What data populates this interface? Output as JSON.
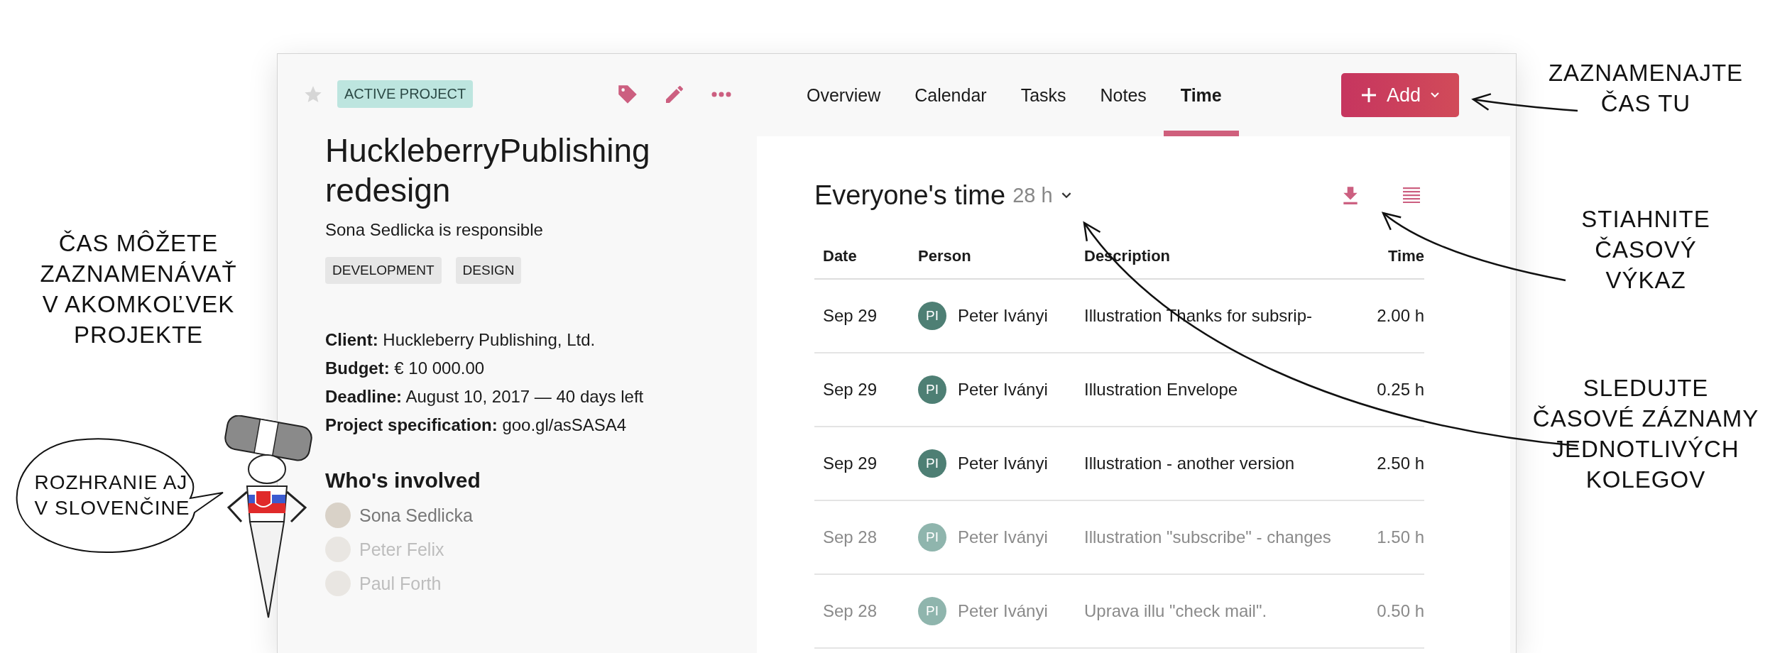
{
  "left_notes": {
    "caption": "ČAS MÔŽETE\nZAZNAMENÁVAŤ\nV AKOMKOĽVEK\nPROJEKTE",
    "speech_bubble": "ROZHRANIE AJ\nV SLOVENČINE"
  },
  "project": {
    "starred": false,
    "status": "ACTIVE PROJECT",
    "title": "HuckleberryPublishing redesign",
    "responsible": "Sona Sedlicka is responsible",
    "tags": [
      "DEVELOPMENT",
      "DESIGN"
    ],
    "details": [
      "**Client:** Huckleberry Publishing, Ltd.",
      "**Budget:** € 10 000.00",
      "**Deadline:** August 10, 2017 — 40 days left",
      "**Project specification:** goo.gl/asSASA4"
    ],
    "involved_heading": "Who's involved",
    "people": [
      {
        "name": "Sona Sedlicka",
        "faded": false
      },
      {
        "name": "Peter Felix",
        "faded": true
      },
      {
        "name": "Paul Forth",
        "faded": true
      }
    ]
  },
  "tabs": [
    {
      "label": "Overview",
      "selected": false
    },
    {
      "label": "Calendar",
      "selected": false
    },
    {
      "label": "Tasks",
      "selected": false
    },
    {
      "label": "Notes",
      "selected": false
    },
    {
      "label": "Time",
      "selected": true
    }
  ],
  "add_button": {
    "label": "Add"
  },
  "time_panel": {
    "title": "Everyone's time",
    "total": "28 h",
    "columns": [
      "Date",
      "Person",
      "Description",
      "Time"
    ],
    "rows": [
      {
        "date": "Sep 29",
        "initials": "PI",
        "person": "Peter Iványi",
        "description": "Illustration Thanks for subsrip-",
        "time": "2.00 h",
        "faded": false
      },
      {
        "date": "Sep 29",
        "initials": "PI",
        "person": "Peter Iványi",
        "description": "Illustration Envelope",
        "time": "0.25 h",
        "faded": false
      },
      {
        "date": "Sep 29",
        "initials": "PI",
        "person": "Peter Iványi",
        "description": "Illustration - another version",
        "time": "2.50 h",
        "faded": false
      },
      {
        "date": "Sep 28",
        "initials": "PI",
        "person": "Peter Iványi",
        "description": "Illustration \"subscribe\" - changes",
        "time": "1.50 h",
        "faded": true
      },
      {
        "date": "Sep 28",
        "initials": "PI",
        "person": "Peter Iványi",
        "description": "Uprava illu \"check mail\".",
        "time": "0.50 h",
        "faded": true
      }
    ]
  },
  "right_notes": [
    "ZAZNAMENAJTE\nČAS TU",
    "STIAHNITE\nČASOVÝ\nVÝKAZ",
    "SLEDUJTE\nČASOVÉ ZÁZNAMY\nJEDNOTLIVÝCH\nKOLEGOV"
  ]
}
